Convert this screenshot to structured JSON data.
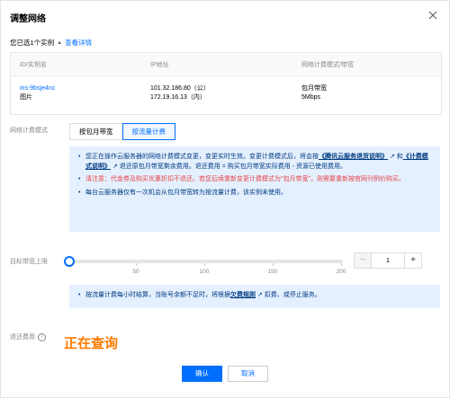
{
  "dialog": {
    "title": "调整网络",
    "close_icon": "close-icon"
  },
  "selection": {
    "prefix": "您已选1个实例",
    "caret": "▲",
    "detail_link": "查看详情"
  },
  "instance_table": {
    "headers": [
      "ID/实例名",
      "IP地址",
      "网络计费模式/带宽"
    ],
    "row": {
      "id": "ins-9bsje4nc",
      "name": "图片",
      "public_ip": "101.32.186.80（公）",
      "private_ip": "172.19.16.13（内）",
      "billing_mode": "包月带宽",
      "bandwidth": "5Mbps"
    }
  },
  "billing_mode": {
    "label": "网络计费模式",
    "tabs": [
      "按包月带宽",
      "按流量计费"
    ],
    "selected": "按流量计费"
  },
  "notice": {
    "item1_a": "您正在操作云服务器的网络计费模式变更，变更实时生效。变更计费模式后，将会按",
    "item1_link1": "《腾讯云服务退货说明》",
    "item1_b": "和",
    "item1_link2": "《计费模式说明》",
    "item1_c": "退还原包月带宽剩余费用。退还费用 = 购买包月带宽实际费用 - 资源已使用费用。",
    "item2_warn_a": "请注意：代金券及购买优惠折扣不退还。若您后续重新变更计费模式为\"包月带宽\"，则需要重新按官网刊例价购买。",
    "item3": "每台云服务器仅有一次机会从包月带宽转为按流量计费，该实例未使用。"
  },
  "bandwidth": {
    "label": "目标带宽上限",
    "ticks": [
      "50",
      "100",
      "150",
      "200"
    ],
    "value": "1",
    "level": 0,
    "minus": "−",
    "plus": "+"
  },
  "notice2": {
    "a": "按流量计费每小时结算，当账号余额不足时，将根据",
    "link": "欠费规则",
    "b": "扣费、或停止服务。"
  },
  "refund": {
    "label": "退还费用",
    "info": "i",
    "status": "正在查询"
  },
  "footer": {
    "confirm": "确认",
    "cancel": "取消"
  }
}
